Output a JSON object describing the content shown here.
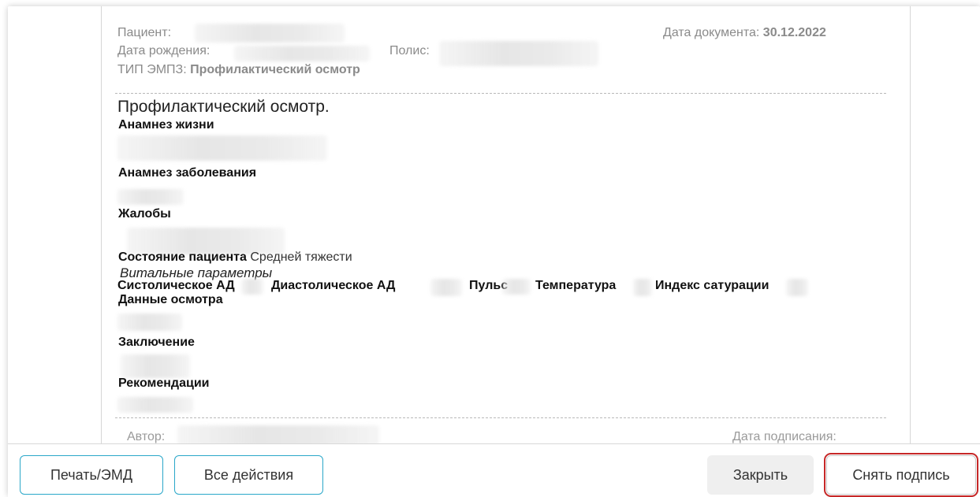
{
  "header": {
    "patient_label": "Пациент:",
    "birthdate_label": "Дата рождения:",
    "policy_label": "Полис:",
    "emd_type_label": "ТИП ЭМПЗ:",
    "emd_type_value": "Профилактический осмотр",
    "doc_date_label": "Дата документа:",
    "doc_date_value": "30.12.2022"
  },
  "document": {
    "title": "Профилактический осмотр.",
    "sections": {
      "life_history": "Анамнез жизни",
      "disease_history": "Анамнез заболевания",
      "complaints": "Жалобы",
      "patient_state_label": "Состояние пациента",
      "patient_state_value": "Средней тяжести",
      "vitals_title": "Витальные параметры",
      "exam_data": "Данные осмотра",
      "conclusion": "Заключение",
      "recommendations": "Рекомендации"
    },
    "vitals": {
      "systolic": "Систолическое АД",
      "diastolic": "Диастолическое АД",
      "pulse": "Пульс",
      "temperature": "Температура",
      "saturation": "Индекс сатурации"
    }
  },
  "footer": {
    "author_label": "Автор:",
    "signed_date_label": "Дата подписания:"
  },
  "toolbar": {
    "print_label": "Печать/ЭМД",
    "all_actions_label": "Все действия",
    "close_label": "Закрыть",
    "remove_signature_label": "Снять подпись"
  }
}
